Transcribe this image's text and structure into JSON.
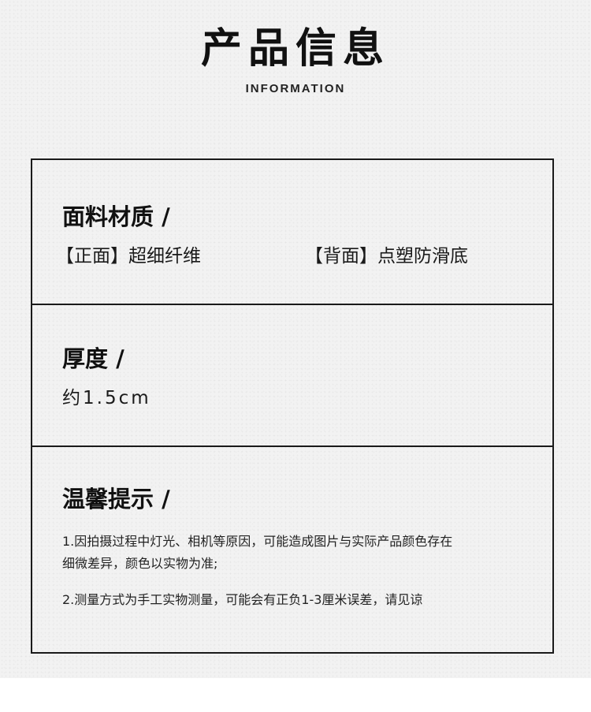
{
  "header": {
    "title": "产品信息",
    "subtitle": "INFORMATION"
  },
  "fabric": {
    "title": "面料材质 /",
    "front": "【正面】超细纤维",
    "back": "【背面】点塑防滑底"
  },
  "thickness": {
    "title": "厚度 /",
    "value": "约1.5cm"
  },
  "tips": {
    "title": "温馨提示 /",
    "line1": "1.因拍摄过程中灯光、相机等原因，可能造成图片与实际产品颜色存在",
    "line2": "细微差异，颜色以实物为准;",
    "line3": "2.测量方式为手工实物测量，可能会有正负1-3厘米误差，请见谅"
  }
}
